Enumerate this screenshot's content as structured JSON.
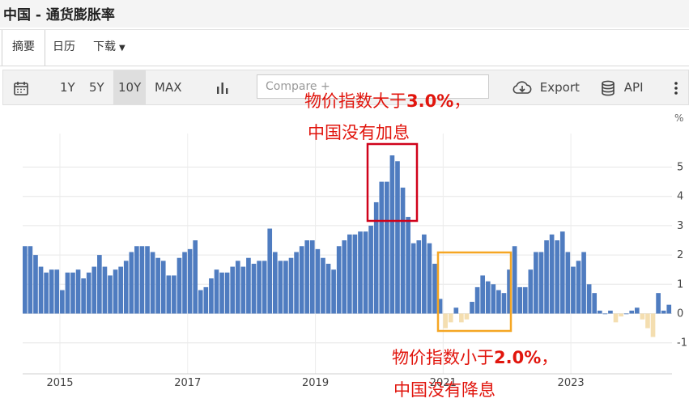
{
  "page": {
    "title": "中国 - 通货膨胀率"
  },
  "tabs": [
    {
      "label": "摘要",
      "active": true
    },
    {
      "label": "日历",
      "active": false
    },
    {
      "label": "下载",
      "active": false
    }
  ],
  "toolbar": {
    "ranges": [
      "1Y",
      "5Y",
      "10Y",
      "MAX"
    ],
    "active_range": "10Y",
    "compare_placeholder": "Compare +",
    "export_label": "Export",
    "api_label": "API",
    "icons": [
      "calendar-icon",
      "bar-chart-icon",
      "cloud-download-icon",
      "database-icon",
      "more-vertical-icon"
    ]
  },
  "annotations": {
    "high": {
      "line1_prefix": "物价指数大于",
      "line1_value": "3.0%",
      "line1_suffix": "，",
      "line2": "中国没有加息",
      "box_color": "#d0021b"
    },
    "low": {
      "line1_prefix": "物价指数小于",
      "line1_value": "2.0%",
      "line1_suffix": "，",
      "line2": "中国没有降息",
      "box_color": "#f5a623"
    }
  },
  "chart_data": {
    "type": "bar",
    "unit": "%",
    "ylim": [
      -1.4,
      5.8
    ],
    "yticks": [
      -1,
      0,
      1,
      2,
      3,
      4,
      5
    ],
    "xticks": [
      "2015",
      "2017",
      "2019",
      "2021",
      "2023"
    ],
    "grid": true,
    "start": "2014-06",
    "frequency": "monthly",
    "positive_color": "#4f7cc0",
    "negative_color": "#f4deb0",
    "values": [
      2.3,
      2.3,
      2.0,
      1.6,
      1.4,
      1.5,
      1.5,
      0.8,
      1.4,
      1.4,
      1.5,
      1.2,
      1.4,
      1.6,
      2.0,
      1.6,
      1.3,
      1.5,
      1.6,
      1.8,
      2.1,
      2.3,
      2.3,
      2.3,
      2.1,
      1.9,
      1.8,
      1.3,
      1.3,
      1.9,
      2.1,
      2.2,
      2.5,
      0.8,
      0.9,
      1.2,
      1.5,
      1.4,
      1.4,
      1.6,
      1.8,
      1.6,
      1.9,
      1.7,
      1.8,
      1.8,
      2.9,
      2.1,
      1.8,
      1.8,
      1.9,
      2.1,
      2.3,
      2.5,
      2.5,
      2.2,
      1.9,
      1.7,
      1.5,
      2.3,
      2.5,
      2.7,
      2.7,
      2.8,
      2.8,
      3.0,
      3.8,
      4.5,
      4.5,
      5.4,
      5.2,
      4.3,
      3.3,
      2.4,
      2.5,
      2.7,
      2.4,
      1.7,
      0.5,
      -0.5,
      -0.3,
      0.2,
      -0.3,
      -0.2,
      0.4,
      0.9,
      1.3,
      1.1,
      1.0,
      0.8,
      0.7,
      1.5,
      2.3,
      0.9,
      0.9,
      1.5,
      2.1,
      2.1,
      2.5,
      2.7,
      2.5,
      2.8,
      2.1,
      1.6,
      1.8,
      2.1,
      1.0,
      0.7,
      0.1,
      0.0,
      0.1,
      -0.3,
      -0.1,
      0.0,
      0.1,
      0.2,
      -0.2,
      -0.5,
      -0.8,
      0.7,
      0.1,
      0.3
    ]
  }
}
